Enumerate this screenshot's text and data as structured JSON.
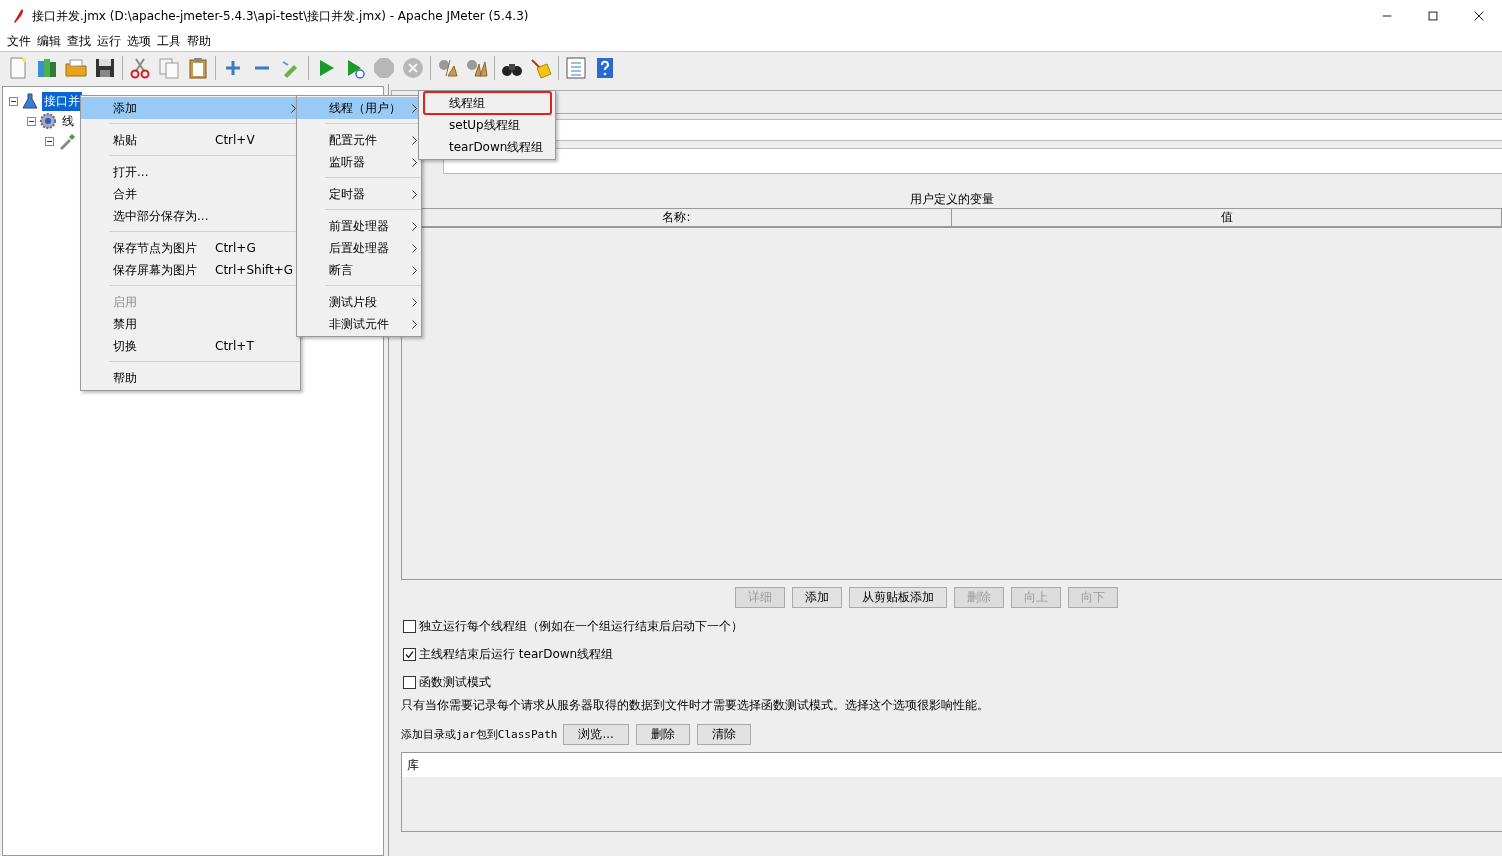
{
  "window": {
    "title": "接口并发.jmx (D:\\apache-jmeter-5.4.3\\api-test\\接口并发.jmx) - Apache JMeter (5.4.3)"
  },
  "menu_bar": [
    "文件",
    "编辑",
    "查找",
    "运行",
    "选项",
    "工具",
    "帮助"
  ],
  "toolbar": [
    {
      "kind": "new",
      "disabled": false
    },
    {
      "kind": "templates",
      "disabled": false
    },
    {
      "kind": "open",
      "disabled": false
    },
    {
      "kind": "save",
      "disabled": false
    },
    {
      "kind": "sep"
    },
    {
      "kind": "cut",
      "disabled": false
    },
    {
      "kind": "copy",
      "disabled": false
    },
    {
      "kind": "paste",
      "disabled": false
    },
    {
      "kind": "sep"
    },
    {
      "kind": "expand",
      "disabled": false
    },
    {
      "kind": "collapse",
      "disabled": false
    },
    {
      "kind": "toggle",
      "disabled": false
    },
    {
      "kind": "sep"
    },
    {
      "kind": "start",
      "disabled": false
    },
    {
      "kind": "start-no-pause",
      "disabled": false
    },
    {
      "kind": "stop",
      "disabled": true
    },
    {
      "kind": "shutdown",
      "disabled": true
    },
    {
      "kind": "sep"
    },
    {
      "kind": "clear",
      "disabled": false
    },
    {
      "kind": "clear-all",
      "disabled": false
    },
    {
      "kind": "sep"
    },
    {
      "kind": "search",
      "disabled": false
    },
    {
      "kind": "reset",
      "disabled": false
    },
    {
      "kind": "sep"
    },
    {
      "kind": "functions",
      "disabled": false
    },
    {
      "kind": "help",
      "disabled": false
    }
  ],
  "tree": [
    {
      "kind": "test-plan",
      "label": "接口并",
      "selected": true,
      "expanded": true,
      "children": [
        {
          "kind": "thread-group",
          "label": "线",
          "selected": false,
          "expanded": true,
          "children": [
            {
              "kind": "sampler",
              "expanded": true
            }
          ]
        }
      ]
    }
  ],
  "variables_table": {
    "title": "用户定义的变量",
    "columns": [
      "名称:",
      "值"
    ]
  },
  "table_buttons": [
    {
      "label": "详细",
      "disabled": true
    },
    {
      "label": "添加",
      "disabled": false
    },
    {
      "label": "从剪贴板添加",
      "disabled": false
    },
    {
      "label": "删除",
      "disabled": true
    },
    {
      "label": "向上",
      "disabled": true
    },
    {
      "label": "向下",
      "disabled": true
    }
  ],
  "options": [
    {
      "label": "独立运行每个线程组（例如在一个组运行结束后启动下一个）",
      "checked": false
    },
    {
      "label": "主线程结束后运行 tearDown线程组",
      "checked": true
    },
    {
      "label": "函数测试模式",
      "checked": false
    }
  ],
  "note": "只有当你需要记录每个请求从服务器取得的数据到文件时才需要选择函数测试模式。选择这个选项很影响性能。",
  "classpath": {
    "label": "添加目录或jar包到ClassPath",
    "buttons": [
      "浏览...",
      "删除",
      "清除"
    ]
  },
  "library_table": {
    "columns": [
      "库"
    ]
  },
  "context_menu": [
    {
      "kind": "item",
      "label": "添加",
      "submenu": true,
      "selected": true,
      "disabled": false
    },
    {
      "kind": "separator"
    },
    {
      "kind": "item",
      "label": "粘贴",
      "shortcut": "Ctrl+V",
      "submenu": false,
      "selected": false,
      "disabled": false
    },
    {
      "kind": "separator"
    },
    {
      "kind": "item",
      "label": "打开...",
      "submenu": false,
      "selected": false,
      "disabled": false
    },
    {
      "kind": "item",
      "label": "合并",
      "submenu": false,
      "selected": false,
      "disabled": false
    },
    {
      "kind": "item",
      "label": "选中部分保存为...",
      "submenu": false,
      "selected": false,
      "disabled": false
    },
    {
      "kind": "separator"
    },
    {
      "kind": "item",
      "label": "保存节点为图片",
      "shortcut": "Ctrl+G",
      "submenu": false,
      "selected": false,
      "disabled": false
    },
    {
      "kind": "item",
      "label": "保存屏幕为图片",
      "shortcut": "Ctrl+Shift+G",
      "submenu": false,
      "selected": false,
      "disabled": false
    },
    {
      "kind": "separator"
    },
    {
      "kind": "item",
      "label": "启用",
      "submenu": false,
      "selected": false,
      "disabled": true
    },
    {
      "kind": "item",
      "label": "禁用",
      "submenu": false,
      "selected": false,
      "disabled": false
    },
    {
      "kind": "item",
      "label": "切换",
      "shortcut": "Ctrl+T",
      "submenu": false,
      "selected": false,
      "disabled": false
    },
    {
      "kind": "separator"
    },
    {
      "kind": "item",
      "label": "帮助",
      "submenu": false,
      "selected": false,
      "disabled": false
    }
  ],
  "add_submenu": [
    {
      "kind": "item",
      "label": "线程（用户）",
      "submenu": true,
      "selected": true,
      "disabled": false
    },
    {
      "kind": "separator"
    },
    {
      "kind": "item",
      "label": "配置元件",
      "submenu": true,
      "selected": false,
      "disabled": false
    },
    {
      "kind": "item",
      "label": "监听器",
      "submenu": true,
      "selected": false,
      "disabled": false
    },
    {
      "kind": "separator"
    },
    {
      "kind": "item",
      "label": "定时器",
      "submenu": true,
      "selected": false,
      "disabled": false
    },
    {
      "kind": "separator"
    },
    {
      "kind": "item",
      "label": "前置处理器",
      "submenu": true,
      "selected": false,
      "disabled": false
    },
    {
      "kind": "item",
      "label": "后置处理器",
      "submenu": true,
      "selected": false,
      "disabled": false
    },
    {
      "kind": "item",
      "label": "断言",
      "submenu": true,
      "selected": false,
      "disabled": false
    },
    {
      "kind": "separator"
    },
    {
      "kind": "item",
      "label": "测试片段",
      "submenu": true,
      "selected": false,
      "disabled": false
    },
    {
      "kind": "item",
      "label": "非测试元件",
      "submenu": true,
      "selected": false,
      "disabled": false
    }
  ],
  "threads_submenu": [
    {
      "kind": "item",
      "label": "线程组",
      "submenu": false,
      "selected": false,
      "disabled": false,
      "highlighted": true
    },
    {
      "kind": "item",
      "label": "setUp线程组",
      "submenu": false,
      "selected": false,
      "disabled": false,
      "highlighted": false
    },
    {
      "kind": "item",
      "label": "tearDown线程组",
      "submenu": false,
      "selected": false,
      "disabled": false,
      "highlighted": false
    }
  ]
}
